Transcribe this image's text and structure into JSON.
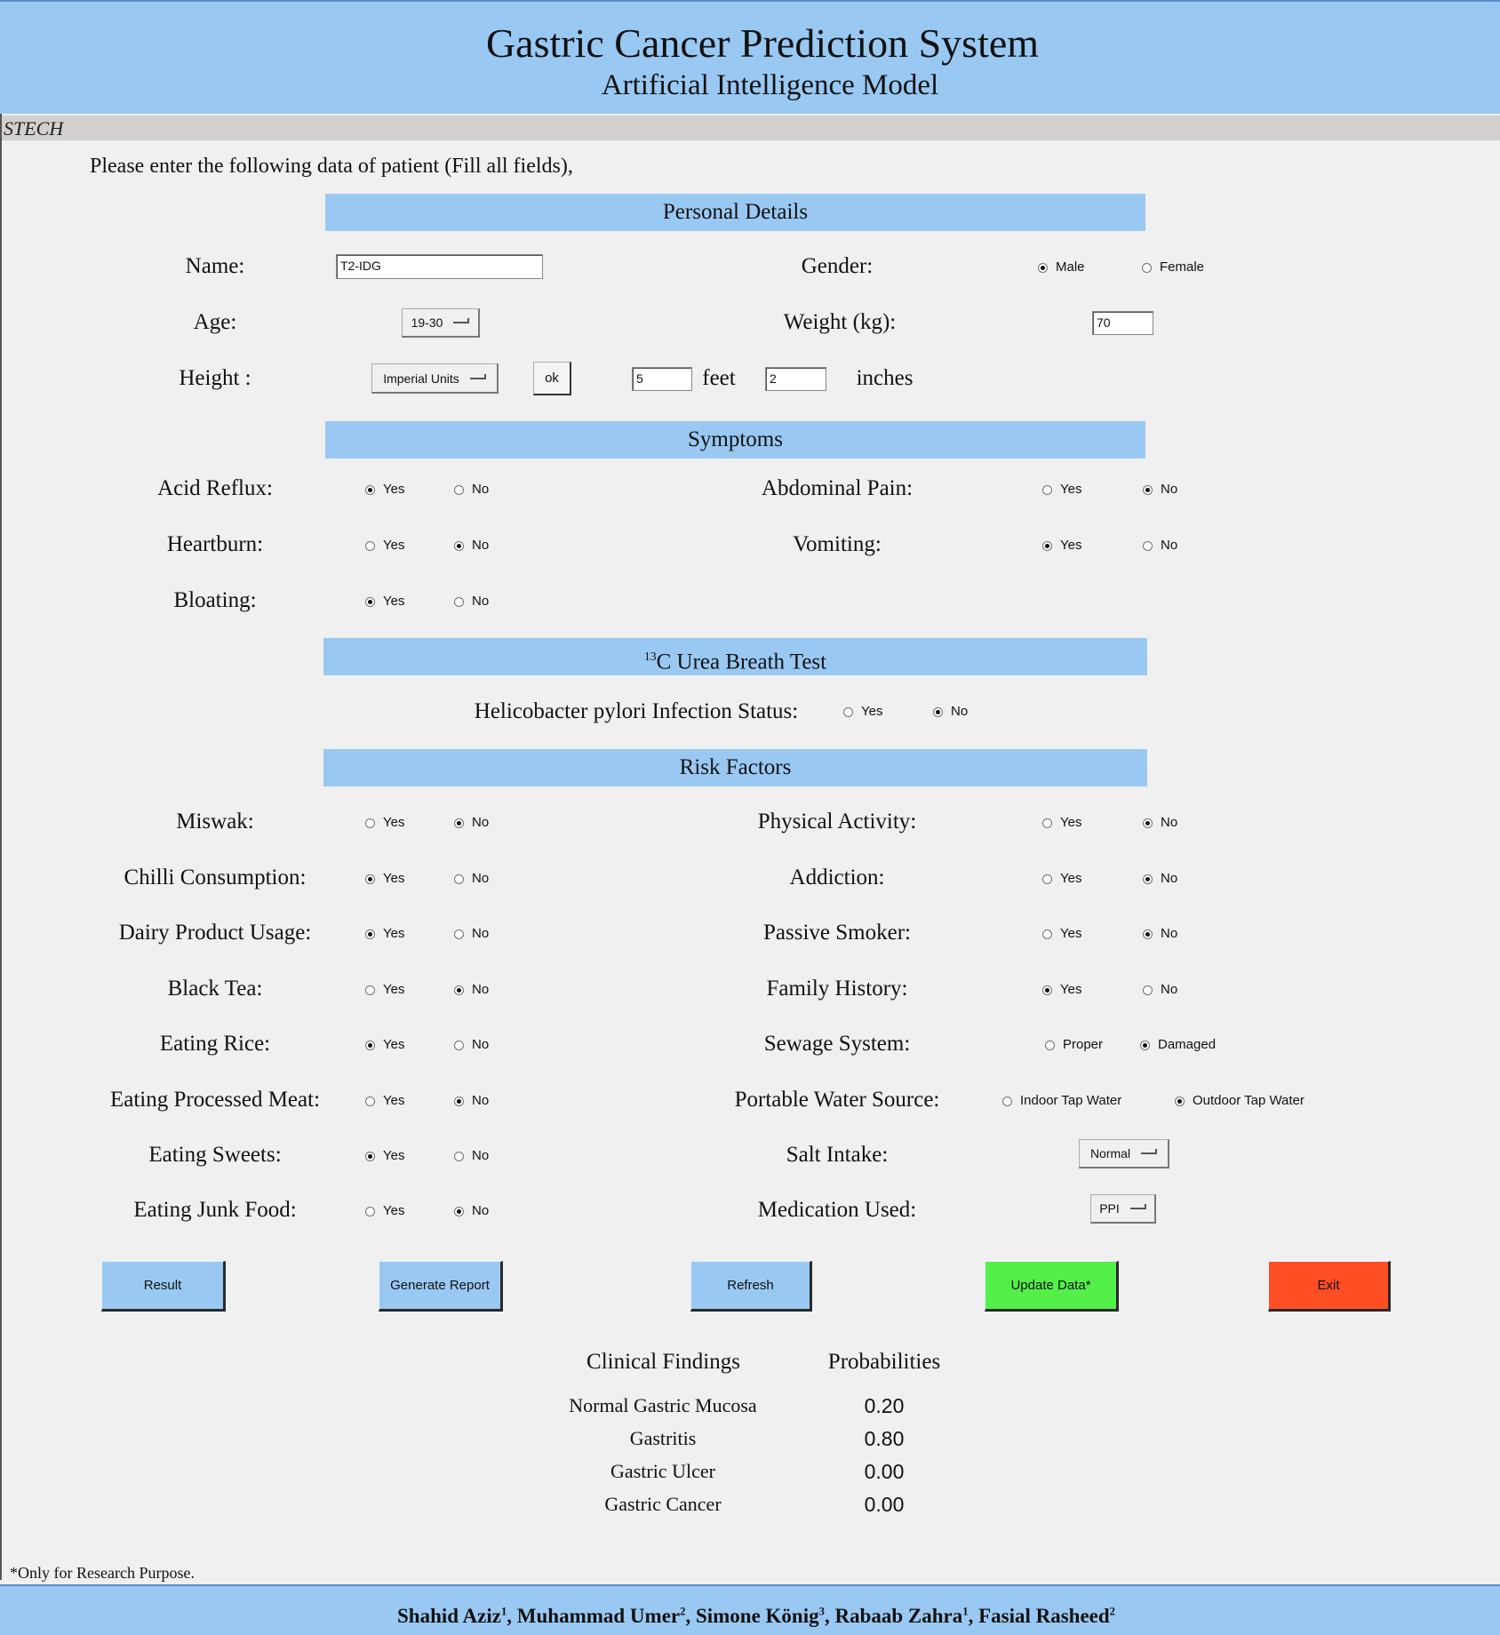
{
  "header": {
    "title": "Gastric Cancer Prediction System",
    "subtitle": "Artificial Intelligence Model"
  },
  "strip_text": "STECH",
  "intro": "Please enter the following data of patient (Fill all fields),",
  "sections": {
    "personal": "Personal Details",
    "symptoms": "Symptoms",
    "breath_test": "C Urea Breath Test",
    "breath_test_sup": "13",
    "risk": "Risk Factors"
  },
  "personal": {
    "name_label": "Name:",
    "name_value": "T2-IDG",
    "gender_label": "Gender:",
    "gender_options": [
      "Male",
      "Female"
    ],
    "gender_selected": "Male",
    "age_label": "Age:",
    "age_value": "19-30",
    "weight_label": "Weight (kg):",
    "weight_value": "70",
    "height_label": "Height :",
    "height_units": "Imperial Units",
    "ok_label": "ok",
    "feet_value": "5",
    "feet_label": "feet",
    "inches_value": "2",
    "inches_label": "inches"
  },
  "symptoms": {
    "acid_reflux": {
      "label": "Acid Reflux:",
      "yes": "Yes",
      "no": "No",
      "selected": "Yes"
    },
    "abdominal_pain": {
      "label": "Abdominal Pain:",
      "yes": "Yes",
      "no": "No",
      "selected": "No"
    },
    "heartburn": {
      "label": "Heartburn:",
      "yes": "Yes",
      "no": "No",
      "selected": "No"
    },
    "vomiting": {
      "label": "Vomiting:",
      "yes": "Yes",
      "no": "No",
      "selected": "Yes"
    },
    "bloating": {
      "label": "Bloating:",
      "yes": "Yes",
      "no": "No",
      "selected": "Yes"
    }
  },
  "breath": {
    "label": "Helicobacter pylori Infection Status:",
    "yes": "Yes",
    "no": "No",
    "selected": "No"
  },
  "risk": {
    "miswak": {
      "label": "Miswak:",
      "yes": "Yes",
      "no": "No",
      "selected": "No"
    },
    "physical_activity": {
      "label": "Physical Activity:",
      "yes": "Yes",
      "no": "No",
      "selected": "No"
    },
    "chilli": {
      "label": "Chilli Consumption:",
      "yes": "Yes",
      "no": "No",
      "selected": "Yes"
    },
    "addiction": {
      "label": "Addiction:",
      "yes": "Yes",
      "no": "No",
      "selected": "No"
    },
    "dairy": {
      "label": "Dairy Product Usage:",
      "yes": "Yes",
      "no": "No",
      "selected": "Yes"
    },
    "passive_smoker": {
      "label": "Passive Smoker:",
      "yes": "Yes",
      "no": "No",
      "selected": "No"
    },
    "black_tea": {
      "label": "Black Tea:",
      "yes": "Yes",
      "no": "No",
      "selected": "No"
    },
    "family_history": {
      "label": "Family History:",
      "yes": "Yes",
      "no": "No",
      "selected": "Yes"
    },
    "eating_rice": {
      "label": "Eating Rice:",
      "yes": "Yes",
      "no": "No",
      "selected": "Yes"
    },
    "sewage": {
      "label": "Sewage System:",
      "yes": "Proper",
      "no": "Damaged",
      "selected": "Damaged"
    },
    "processed_meat": {
      "label": "Eating Processed Meat:",
      "yes": "Yes",
      "no": "No",
      "selected": "No"
    },
    "water_source": {
      "label": "Portable Water Source:",
      "yes": "Indoor Tap Water",
      "no": "Outdoor Tap Water",
      "selected": "Outdoor Tap Water"
    },
    "sweets": {
      "label": "Eating Sweets:",
      "yes": "Yes",
      "no": "No",
      "selected": "Yes"
    },
    "salt_intake": {
      "label": "Salt Intake:",
      "value": "Normal"
    },
    "junk_food": {
      "label": "Eating Junk Food:",
      "yes": "Yes",
      "no": "No",
      "selected": "No"
    },
    "medication": {
      "label": "Medication Used:",
      "value": "PPI"
    }
  },
  "buttons": {
    "result": "Result",
    "report": "Generate Report",
    "refresh": "Refresh",
    "update": "Update Data*",
    "exit": "Exit"
  },
  "colors": {
    "header_bg": "#99c9f3",
    "button_blue": "#99c9f3",
    "button_green": "#53f04a",
    "button_red": "#ff4d24"
  },
  "results": {
    "col1": "Clinical Findings",
    "col2": "Probabilities",
    "rows": [
      {
        "finding": "Normal Gastric Mucosa",
        "prob": "0.20"
      },
      {
        "finding": "Gastritis",
        "prob": "0.80"
      },
      {
        "finding": "Gastric Ulcer",
        "prob": "0.00"
      },
      {
        "finding": "Gastric Cancer",
        "prob": "0.00"
      }
    ]
  },
  "note": "*Only for Research Purpose.",
  "authors": [
    {
      "name": "Shahid Aziz",
      "sup": "1"
    },
    {
      "name": "Muhammad Umer",
      "sup": "2"
    },
    {
      "name": "Simone König",
      "sup": "3"
    },
    {
      "name": "Rabaab Zahra",
      "sup": "1"
    },
    {
      "name": "Fasial Rasheed",
      "sup": "2"
    }
  ]
}
